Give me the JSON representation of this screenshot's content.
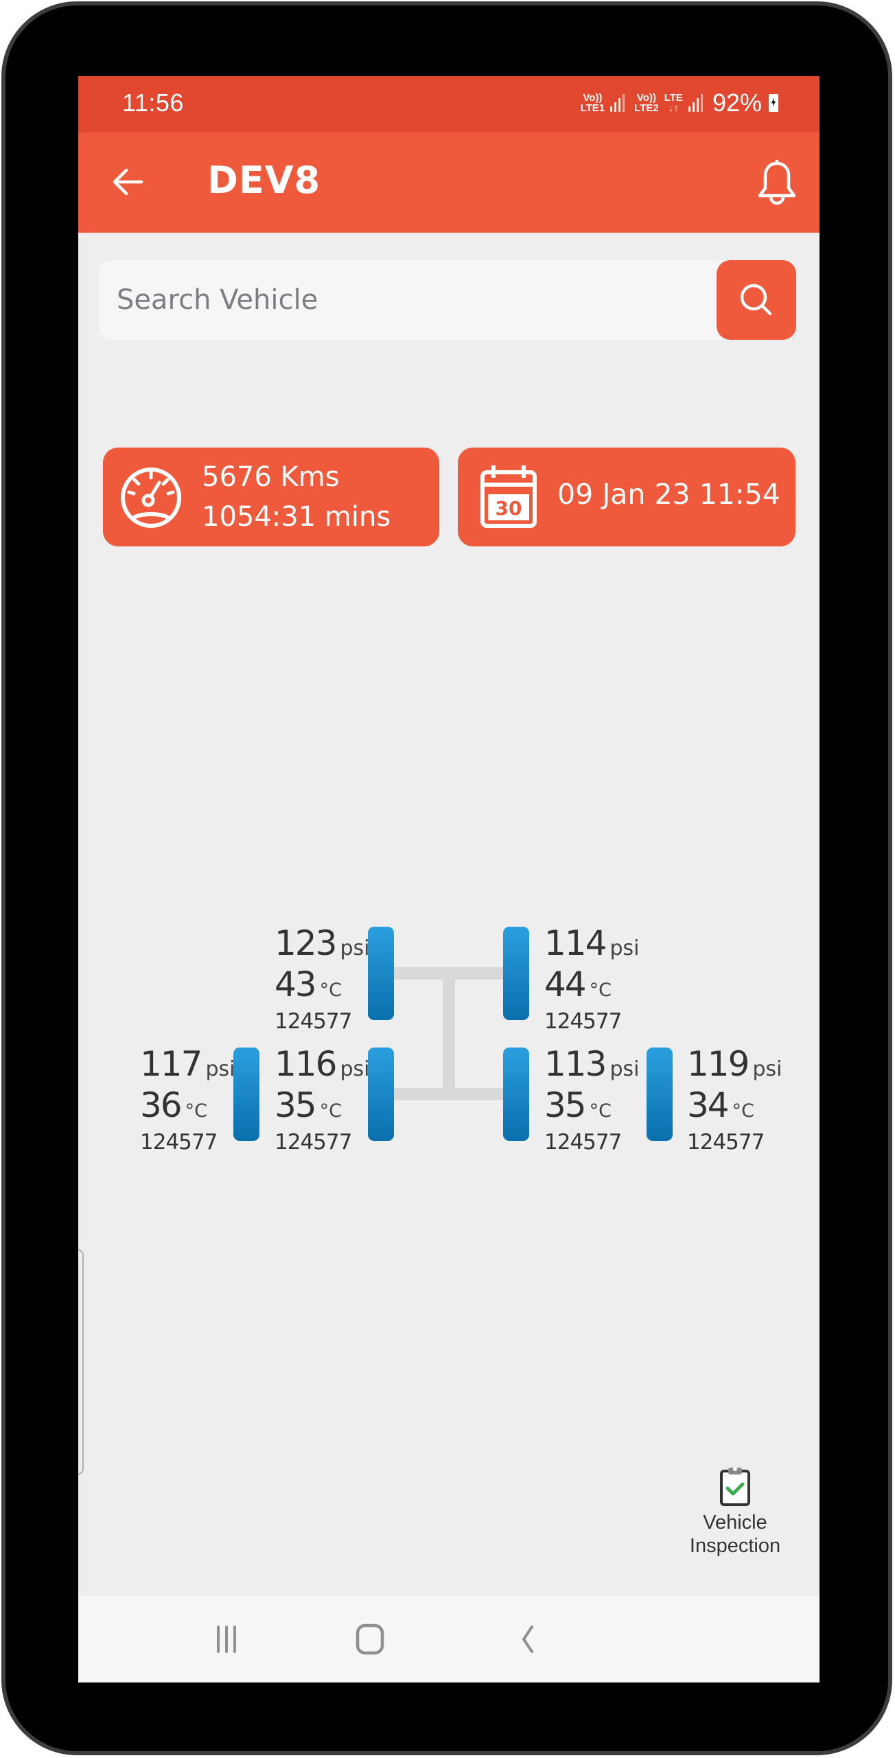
{
  "status_bar": {
    "time": "11:56",
    "sim1": {
      "top": "Vo))",
      "bottom": "LTE1"
    },
    "sim2": {
      "top": "Vo))",
      "bottom": "LTE2"
    },
    "data": {
      "top": "LTE",
      "bottom": "↓↑"
    },
    "battery": "92%"
  },
  "app_bar": {
    "title": "DEV8",
    "back_icon": "arrow-left-icon",
    "notification_icon": "bell-icon"
  },
  "search": {
    "placeholder": "Search Vehicle",
    "value": "",
    "button_icon": "search-icon"
  },
  "summary": {
    "distance": "5676 Kms",
    "duration": "1054:31 mins",
    "odometer_icon": "speedometer-icon",
    "datetime": "09 Jan 23 11:54",
    "calendar_icon": "calendar-icon",
    "calendar_day": "30"
  },
  "tyres": {
    "front_left": {
      "pressure": "123",
      "pressure_unit": "psi",
      "temperature": "43",
      "temp_unit": "°C",
      "sensor_id": "124577"
    },
    "front_right": {
      "pressure": "114",
      "pressure_unit": "psi",
      "temperature": "44",
      "temp_unit": "°C",
      "sensor_id": "124577"
    },
    "rear_left_outer": {
      "pressure": "117",
      "pressure_unit": "psi",
      "temperature": "36",
      "temp_unit": "°C",
      "sensor_id": "124577"
    },
    "rear_left_inner": {
      "pressure": "116",
      "pressure_unit": "psi",
      "temperature": "35",
      "temp_unit": "°C",
      "sensor_id": "124577"
    },
    "rear_right_inner": {
      "pressure": "113",
      "pressure_unit": "psi",
      "temperature": "35",
      "temp_unit": "°C",
      "sensor_id": "124577"
    },
    "rear_right_outer": {
      "pressure": "119",
      "pressure_unit": "psi",
      "temperature": "34",
      "temp_unit": "°C",
      "sensor_id": "124577"
    }
  },
  "inspection": {
    "label_line1": "Vehicle",
    "label_line2": "Inspection",
    "icon": "clipboard-check-icon"
  },
  "nav_bar": {
    "recents_icon": "recents-icon",
    "home_icon": "home-icon",
    "back_icon": "back-icon"
  },
  "colors": {
    "status_bar": "#e2472f",
    "accent": "#ef5a3c",
    "tyre_top": "#2b9fde",
    "tyre_bottom": "#0a6fad",
    "axle": "#d9d9d9",
    "background": "#eeeeee",
    "check": "#3dab4a"
  }
}
